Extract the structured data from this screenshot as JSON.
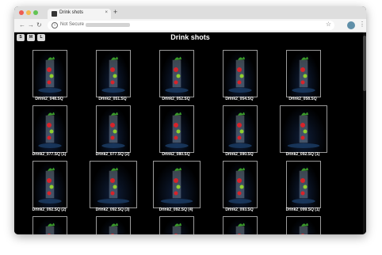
{
  "browser": {
    "tab_title": "Drink shots",
    "tab_close": "×",
    "new_tab": "+",
    "nav": {
      "back": "←",
      "forward": "→",
      "reload": "↻"
    },
    "omnibox": {
      "info_icon": "i",
      "security_label": "Not Secure",
      "star": "☆"
    },
    "menu": "⋮",
    "traffic_lights": {
      "close": "#ee5d52",
      "minimize": "#f5bd4f",
      "maximize": "#62c454"
    }
  },
  "page": {
    "title": "Drink shots",
    "size_buttons": [
      "S",
      "M",
      "L"
    ],
    "captions": [
      "Drink2_048.SQ",
      "Drink2_051.SQ",
      "Drink2_052.SQ",
      "Drink2_054.SQ",
      "Drink2_058.SQ",
      "Drink2_077.SQ (1)",
      "Drink2_077.SQ (2)",
      "Drink2_080.SQ",
      "Drink2_090.SQ",
      "Drink2_092.SQ (1)",
      "Drink2_092.SQ (2)",
      "Drink2_092.SQ (3)",
      "Drink2_092.SQ (4)",
      "Drink2_093.SQ",
      "Drink2_099.SQ (1)",
      "",
      "",
      "",
      "",
      ""
    ]
  },
  "colors": {
    "page_bg": "#000000",
    "thumb_border": "#9a9a9a",
    "glass": "#cfe6f5",
    "fruit_red": "#d8232a",
    "fruit_green": "#8fcf2e",
    "leaf": "#3a9a2a"
  }
}
